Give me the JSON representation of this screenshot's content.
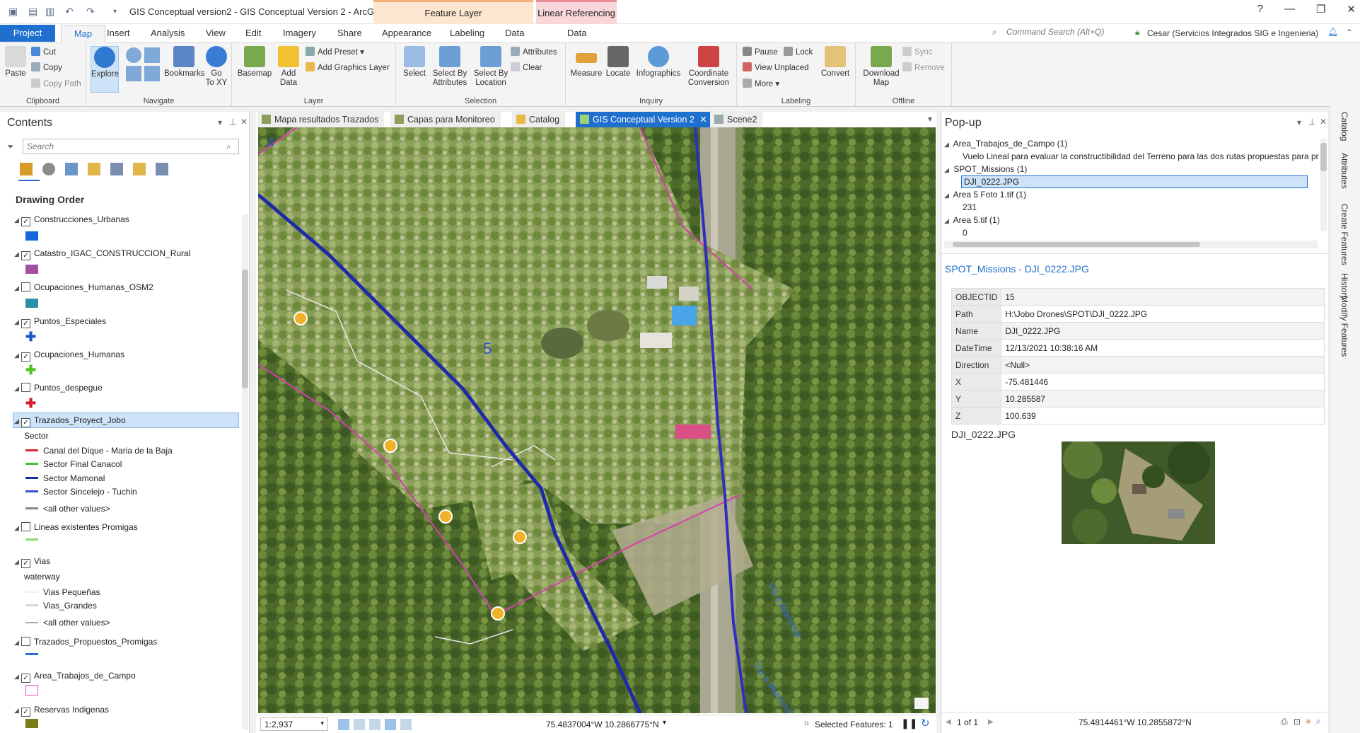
{
  "app": {
    "title": "GIS Conceptual version2 - GIS Conceptual Version 2 - ArcGIS Pro",
    "context_tabs": [
      "Feature Layer",
      "Linear Referencing"
    ],
    "window_controls": [
      "?",
      "—",
      "❐",
      "✕"
    ]
  },
  "ribbon_tabs": [
    "Project",
    "Map",
    "Insert",
    "Analysis",
    "View",
    "Edit",
    "Imagery",
    "Share",
    "Appearance",
    "Labeling",
    "Data",
    "Data"
  ],
  "command_search": "Command Search (Alt+Q)",
  "user": "Cesar (Servicios Integrados SIG e Ingenieria)",
  "ribbon": {
    "clipboard": {
      "label": "Clipboard",
      "paste": "Paste",
      "cut": "Cut",
      "copy": "Copy",
      "copy_path": "Copy Path"
    },
    "navigate": {
      "label": "Navigate",
      "explore": "Explore",
      "bookmarks": "Bookmarks",
      "goto": "Go\nTo XY"
    },
    "layer": {
      "label": "Layer",
      "basemap": "Basemap",
      "add_data": "Add\nData",
      "add_preset": "Add Preset",
      "add_graphics": "Add Graphics Layer"
    },
    "selection": {
      "label": "Selection",
      "select": "Select",
      "select_by_attr": "Select By\nAttributes",
      "select_by_loc": "Select By\nLocation",
      "attributes": "Attributes",
      "clear": "Clear"
    },
    "inquiry": {
      "label": "Inquiry",
      "measure": "Measure",
      "locate": "Locate",
      "infographics": "Infographics",
      "coord_conv": "Coordinate\nConversion"
    },
    "labeling": {
      "label": "Labeling",
      "pause": "Pause",
      "lock": "Lock",
      "view_unplaced": "View Unplaced",
      "more": "More",
      "convert": "Convert"
    },
    "offline": {
      "label": "Offline",
      "download": "Download\nMap",
      "sync": "Sync",
      "remove": "Remove"
    }
  },
  "contents": {
    "title": "Contents",
    "search_placeholder": "Search",
    "drawing_order": "Drawing Order",
    "layers": [
      {
        "name": "Construcciones_Urbanas",
        "checked": true,
        "color": "#1565e0",
        "kind": "rect"
      },
      {
        "name": "Catastro_IGAC_CONSTRUCCION_Rural",
        "checked": true,
        "color": "#a44ea0",
        "kind": "rect"
      },
      {
        "name": "Ocupaciones_Humanas_OSM2",
        "checked": false,
        "color": "#2a8fa8",
        "kind": "rect"
      },
      {
        "name": "Puntos_Especiales",
        "checked": true,
        "color": "#1d56c8",
        "kind": "cross"
      },
      {
        "name": "Ocupaciones_Humanas",
        "checked": true,
        "color": "#4dc520",
        "kind": "cross"
      },
      {
        "name": "Puntos_despegue",
        "checked": false,
        "color": "#d21f2a",
        "kind": "cross"
      },
      {
        "name": "Trazados_Proyect_Jobo",
        "checked": true,
        "selected": true
      }
    ],
    "trazados_field": "Sector",
    "trazados_legend": [
      {
        "label": "Canal del Dique - Maria de la Baja",
        "color": "#d7263d"
      },
      {
        "name_key": "x",
        "label": "Sector Final Canacol",
        "color": "#3bc62a"
      },
      {
        "label": "Sector Mamonal",
        "color": "#1e2aa8"
      },
      {
        "label": "Sector Sincelejo - Tuchin",
        "color": "#2f4fd8"
      },
      {
        "label": "<all other values>",
        "color": "#888888"
      }
    ],
    "lineas": {
      "name": "Lineas existentes Promigas",
      "checked": false,
      "color": "#88e06a"
    },
    "vias": {
      "name": "Vias",
      "checked": true,
      "field": "waterway",
      "legend": [
        "Vias Pequeñas",
        "Vias_Grandes",
        "<all other values>"
      ]
    },
    "trazados_prop": {
      "name": "Trazados_Propuestos_Promigas",
      "checked": false,
      "color": "#2f6fd8"
    },
    "area": {
      "name": "Area_Trabajos_de_Campo",
      "checked": true,
      "color": "#e24fc4"
    },
    "reservas": {
      "name": "Reservas Indigenas",
      "checked": true,
      "color": "#7d7a18"
    }
  },
  "view_tabs": [
    "Mapa resultados Trazados",
    "Capas para Monitoreo",
    "Catalog",
    "GIS Conceptual Version 2",
    "Scene2"
  ],
  "map": {
    "labels": {
      "area4": "4",
      "area5": "5",
      "road1": "Vía a Mamonal",
      "road2": "Vía a Mamonal"
    }
  },
  "map_status": {
    "scale": "1:2,937",
    "coords": "75.4837004°W 10.2866775°N",
    "selected_features": "Selected Features: 1"
  },
  "popup": {
    "title": "Pop-up",
    "tree": [
      {
        "label": "Area_Trabajos_de_Campo  (1)"
      },
      {
        "label": "Vuelo Lineal para evaluar la constructibilidad del Terreno para las dos rutas propuestas para pr",
        "child": true
      },
      {
        "label": "SPOT_Missions  (1)"
      },
      {
        "label": "DJI_0222.JPG",
        "child": true,
        "selected": true
      },
      {
        "label": "Area 5 Foto 1.tif  (1)"
      },
      {
        "label": "231",
        "child": true
      },
      {
        "label": "Area 5.tif  (1)"
      },
      {
        "label": "0",
        "child": true
      }
    ],
    "heading": "SPOT_Missions - DJI_0222.JPG",
    "fields": [
      {
        "k": "OBJECTID",
        "v": "15"
      },
      {
        "k": "Path",
        "v": "H:\\Jobo Drones\\SPOT\\DJI_0222.JPG"
      },
      {
        "k": "Name",
        "v": "DJI_0222.JPG"
      },
      {
        "k": "DateTime",
        "v": "12/13/2021 10:38:16 AM"
      },
      {
        "k": "Direction",
        "v": "<Null>"
      },
      {
        "k": "X",
        "v": "-75.481446"
      },
      {
        "k": "Y",
        "v": "10.285587"
      },
      {
        "k": "Z",
        "v": "100.639"
      }
    ],
    "image_caption": "DJI_0222.JPG",
    "pager": "1 of 1",
    "coords": "75.4814461°W 10.2855872°N"
  },
  "right_sidebar": [
    "Catalog",
    "Attributes",
    "Create Features",
    "History",
    "Modify Features"
  ]
}
